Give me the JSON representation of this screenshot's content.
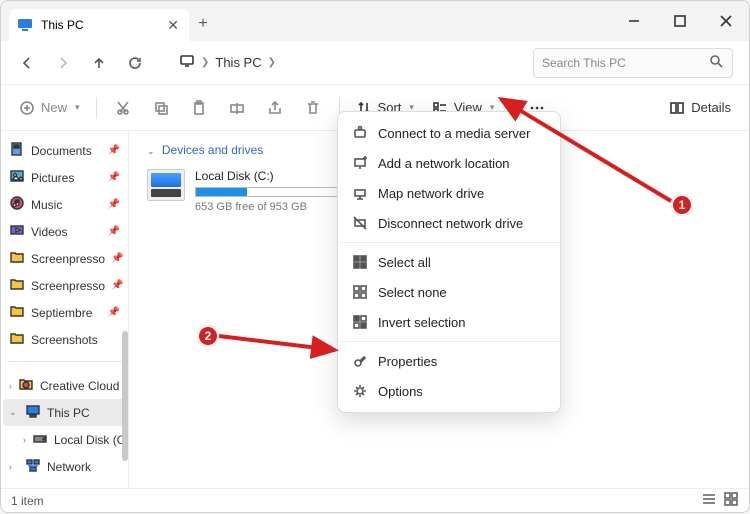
{
  "tab": {
    "title": "This PC"
  },
  "breadcrumb": {
    "root_icon": "monitor-icon",
    "items": [
      "This PC"
    ]
  },
  "search": {
    "placeholder": "Search This PC"
  },
  "toolbar": {
    "new_label": "New",
    "sort_label": "Sort",
    "view_label": "View",
    "details_label": "Details"
  },
  "sidebar": {
    "quick": [
      {
        "label": "Documents",
        "icon": "documents",
        "pinned": true
      },
      {
        "label": "Pictures",
        "icon": "pictures",
        "pinned": true
      },
      {
        "label": "Music",
        "icon": "music",
        "pinned": true
      },
      {
        "label": "Videos",
        "icon": "videos",
        "pinned": true
      },
      {
        "label": "Screenpresso",
        "icon": "folder",
        "pinned": true
      },
      {
        "label": "Screenpresso",
        "icon": "folder",
        "pinned": true
      },
      {
        "label": "Septiembre",
        "icon": "folder",
        "pinned": true
      },
      {
        "label": "Screenshots",
        "icon": "folder",
        "pinned": false
      }
    ],
    "tree": [
      {
        "label": "Creative Cloud F",
        "icon": "cc",
        "expanded": false
      },
      {
        "label": "This PC",
        "icon": "thispc",
        "expanded": true,
        "selected": true
      },
      {
        "label": "Local Disk (C:)",
        "icon": "disk",
        "expanded": false,
        "indent": 1
      },
      {
        "label": "Network",
        "icon": "network",
        "expanded": false
      }
    ]
  },
  "content": {
    "section_title": "Devices and drives",
    "drive": {
      "name": "Local Disk (C:)",
      "free_text": "653 GB free of 953 GB",
      "used_pct": 32
    }
  },
  "menu": {
    "groups": [
      [
        {
          "label": "Connect to a media server",
          "icon": "media"
        },
        {
          "label": "Add a network location",
          "icon": "addnet"
        },
        {
          "label": "Map network drive",
          "icon": "mapnet"
        },
        {
          "label": "Disconnect network drive",
          "icon": "disconnect"
        }
      ],
      [
        {
          "label": "Select all",
          "icon": "selectall"
        },
        {
          "label": "Select none",
          "icon": "selectnone"
        },
        {
          "label": "Invert selection",
          "icon": "invert"
        }
      ],
      [
        {
          "label": "Properties",
          "icon": "props"
        },
        {
          "label": "Options",
          "icon": "options"
        }
      ]
    ]
  },
  "status": {
    "text": "1 item"
  },
  "annotations": {
    "badge1": "1",
    "badge2": "2"
  }
}
